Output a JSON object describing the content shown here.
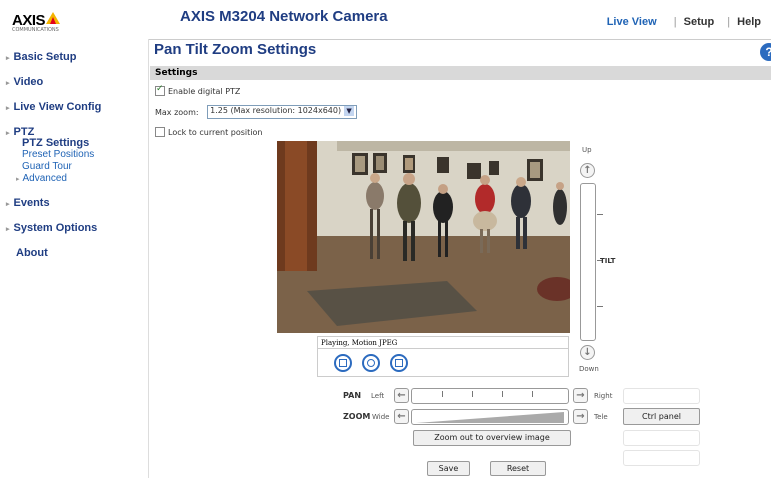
{
  "header": {
    "logo_text": "AXIS",
    "logo_tagline": "COMMUNICATIONS",
    "product_title": "AXIS M3204 Network Camera",
    "nav": {
      "live_view": "Live View",
      "separator": "|",
      "setup": "Setup",
      "help": "Help"
    }
  },
  "sidebar": {
    "basic_setup": "Basic Setup",
    "video": "Video",
    "live_view_config": "Live View Config",
    "ptz": "PTZ",
    "ptz_sub": {
      "ptz_settings": "PTZ Settings",
      "preset_positions": "Preset Positions",
      "guard_tour": "Guard Tour",
      "advanced": "Advanced"
    },
    "events": "Events",
    "system_options": "System Options",
    "about": "About"
  },
  "main": {
    "title": "Pan Tilt Zoom Settings",
    "help_icon_glyph": "?",
    "section_label": "Settings",
    "enable_digital_ptz": {
      "label": "Enable digital PTZ",
      "checked": true
    },
    "max_zoom": {
      "label": "Max zoom:",
      "value": "1.25 (Max resolution: 1024x640)"
    },
    "lock_position": {
      "label": "Lock to current position",
      "checked": false
    }
  },
  "video": {
    "status_text": "Playing, Motion JPEG"
  },
  "ptz": {
    "up_label": "Up",
    "down_label": "Down",
    "tilt_label": "TILT",
    "pan_label": "PAN",
    "left_label": "Left",
    "right_label": "Right",
    "zoom_label": "ZOOM",
    "wide_label": "Wide",
    "tele_label": "Tele",
    "ctrl_panel_button": "Ctrl panel",
    "zoom_out_button": "Zoom out to overview image"
  },
  "buttons": {
    "save": "Save",
    "reset": "Reset"
  },
  "colors": {
    "brand_blue": "#1f3d82",
    "link_blue": "#1f63b5",
    "settings_bar": "#d9d9d9"
  }
}
